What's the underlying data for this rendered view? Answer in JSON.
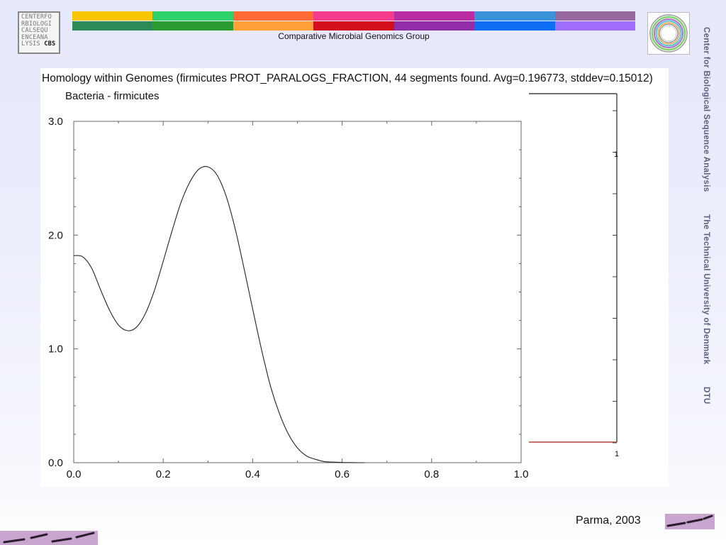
{
  "header": {
    "logo_rows": [
      "CENTERFO",
      "RBIOLOGI",
      "CALSEQU",
      "ENCEANA",
      "LYSIS"
    ],
    "logo_cbs": "CBS",
    "group_label": "Comparative Microbial Genomics Group",
    "stripe_colors_top": [
      "#f7c600",
      "#2fd26b",
      "#ff6a35",
      "#f43a8d",
      "#b82ea2",
      "#3a93d6",
      "#97689e"
    ],
    "stripe_colors_bottom": [
      "#2e8b57",
      "#2a9a33",
      "#ffa039",
      "#d40f1d",
      "#922ea8",
      "#0f6ef6",
      "#9f6dfb"
    ]
  },
  "sidebar": {
    "text1": "Center for Biological Sequence Analysis",
    "text2": "The Technical University of Denmark",
    "text3": "DTU"
  },
  "footer": {
    "text": "Parma, 2003"
  },
  "chart_data": {
    "type": "line",
    "title": "Homology within Genomes (firmicutes  PROT_PARALOGS_FRACTION, 44 segments found. Avg=0.196773, stddev=0.15012)",
    "subtitle": "Bacteria - firmicutes",
    "xlim": [
      0.0,
      1.0
    ],
    "ylim": [
      0.0,
      3.0
    ],
    "x_ticks": [
      "0.0",
      "0.2",
      "0.4",
      "0.6",
      "0.8",
      "1.0"
    ],
    "y_ticks": [
      "0.0",
      "1.0",
      "2.0",
      "3.0"
    ],
    "series": [
      {
        "x": [
          0.0,
          0.02,
          0.04,
          0.06,
          0.08,
          0.1,
          0.12,
          0.14,
          0.16,
          0.18,
          0.2,
          0.22,
          0.24,
          0.26,
          0.28,
          0.3,
          0.32,
          0.34,
          0.36,
          0.38,
          0.4,
          0.42,
          0.44,
          0.46,
          0.48,
          0.5,
          0.52,
          0.54,
          0.56,
          0.58,
          0.6,
          0.62,
          0.64,
          0.65
        ],
        "y": [
          1.82,
          1.81,
          1.71,
          1.52,
          1.34,
          1.21,
          1.16,
          1.19,
          1.31,
          1.51,
          1.77,
          2.04,
          2.29,
          2.47,
          2.58,
          2.6,
          2.53,
          2.35,
          2.07,
          1.72,
          1.35,
          0.99,
          0.67,
          0.43,
          0.25,
          0.13,
          0.06,
          0.03,
          0.01,
          0.005,
          0.002,
          0.001,
          0.0,
          0.0
        ]
      }
    ],
    "background_panel": {
      "right_tick_labels": [
        "1",
        "1"
      ]
    }
  }
}
